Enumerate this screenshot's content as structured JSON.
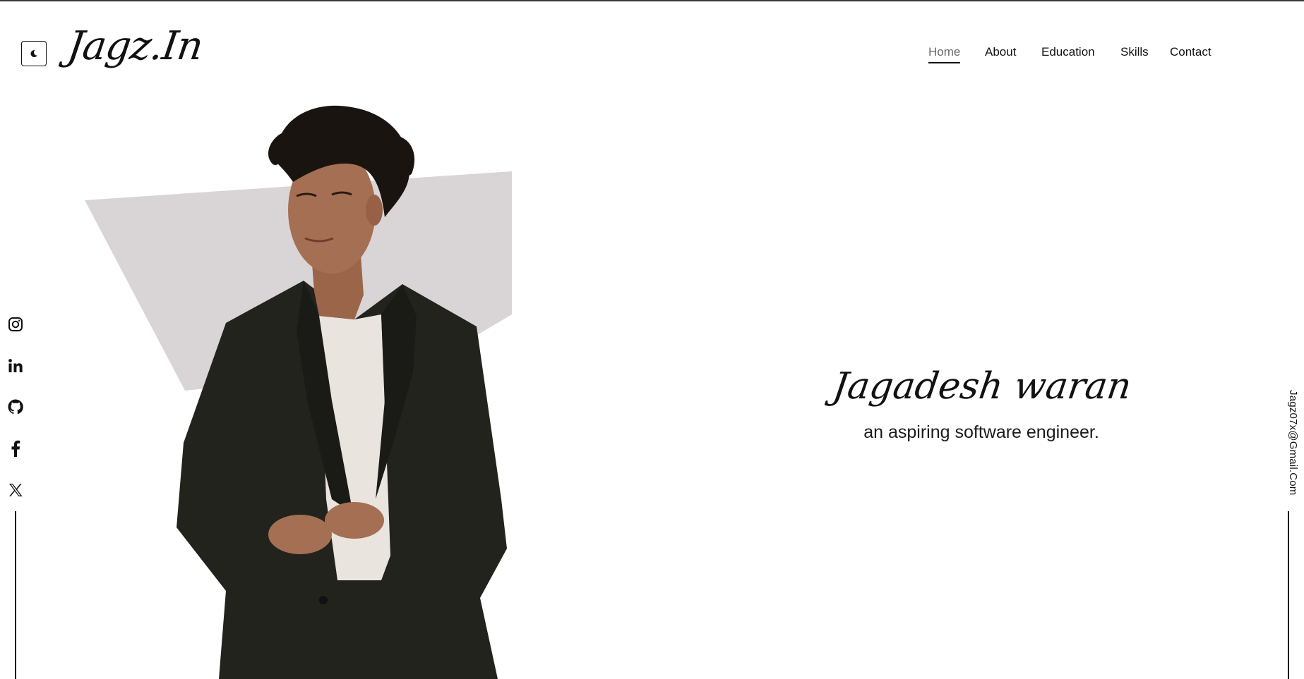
{
  "brand": {
    "logo_text": "Jagz.In"
  },
  "header": {
    "theme_toggle_icon": "moon-icon"
  },
  "nav": {
    "items": [
      {
        "label": "Home",
        "active": true
      },
      {
        "label": "About",
        "active": false
      },
      {
        "label": "Education",
        "active": false
      },
      {
        "label": "Skills",
        "active": false
      },
      {
        "label": "Contact",
        "active": false
      }
    ]
  },
  "social": {
    "icons": [
      "instagram-icon",
      "linkedin-icon",
      "github-icon",
      "facebook-icon",
      "x-twitter-icon"
    ]
  },
  "hero": {
    "name": "Jagadesh waran",
    "tagline": "an aspiring software engineer.",
    "shape_color": "#d9d5d6",
    "jacket_color": "#23231d",
    "shirt_color": "#e9e4de",
    "skin_color": "#a46f53",
    "hair_color": "#1a1410"
  },
  "contact": {
    "email": "Jagz07x@Gmail.Com"
  }
}
